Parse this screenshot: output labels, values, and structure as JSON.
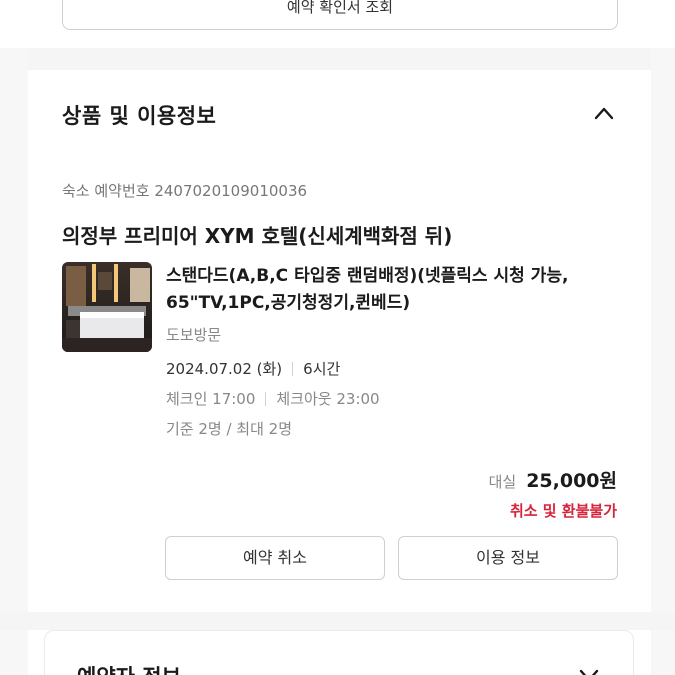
{
  "top_button": {
    "label": "예약 확인서 조회"
  },
  "product_section": {
    "title": "상품 및 이용정보",
    "toggle_icon": "chevron-up-icon",
    "booking_number": "숙소 예약번호 2407020109010036",
    "hotel_name": "의정부 프리미어 XYM 호텔(신세계백화점 뒤)",
    "room_name": "스탠다드(A,B,C 타입중 랜덤배정)(넷플릭스 시청 가능, 65\"TV,1PC,공기청정기,퀸베드)",
    "visit_type": "도보방문",
    "date": "2024.07.02 (화)",
    "duration": "6시간",
    "checkin": "체크인 17:00",
    "checkout": "체크아웃 23:00",
    "capacity": "기준 2명 / 최대 2명",
    "price_label": "대실",
    "price": "25,000원",
    "refund_policy": "취소 및 환불불가",
    "cancel_button": "예약 취소",
    "info_button": "이용 정보"
  },
  "booker_section": {
    "title": "예약자 정보",
    "toggle_icon": "chevron-down-icon"
  },
  "colors": {
    "accent_red": "#d6243c",
    "border": "#cfcfcf",
    "muted_text": "#888888"
  }
}
